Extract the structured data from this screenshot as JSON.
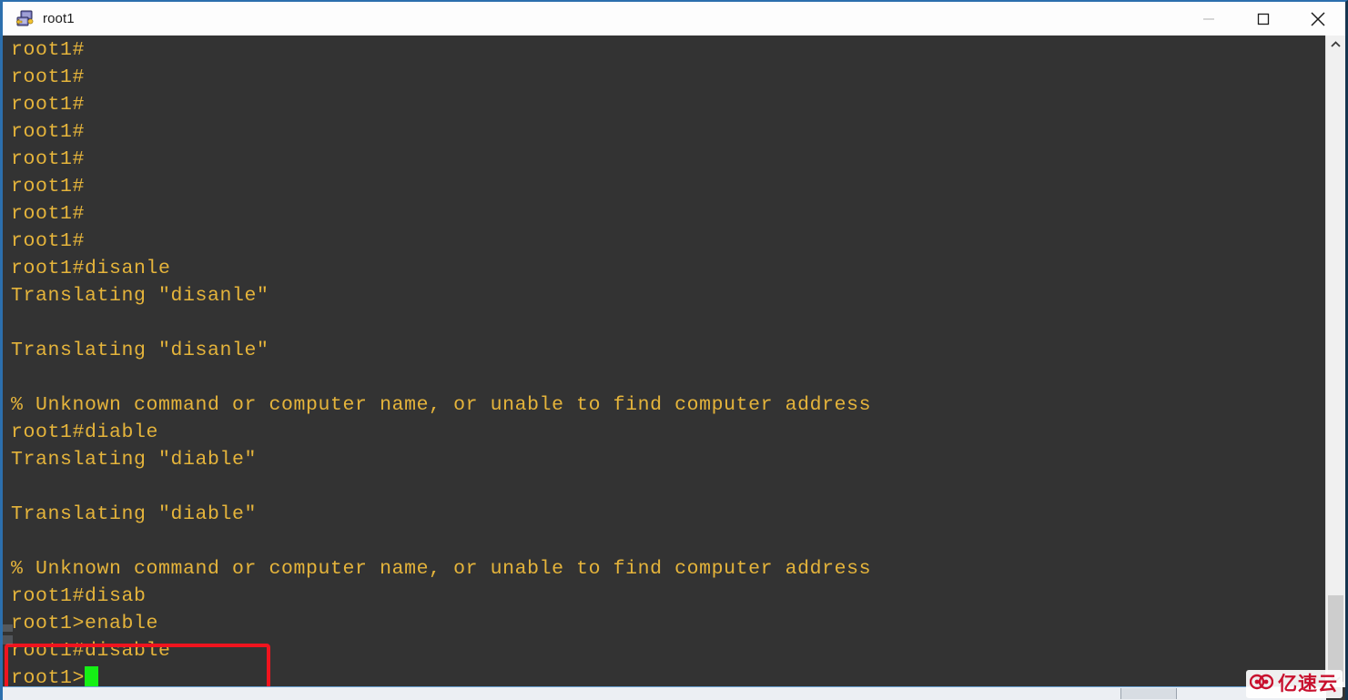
{
  "window": {
    "title": "root1",
    "icon": "remote-computer-icon",
    "controls": {
      "minimize": "minimize-icon",
      "maximize": "maximize-icon",
      "close": "close-icon"
    }
  },
  "terminal": {
    "foreground_color": "#e5b43b",
    "background_color": "#333333",
    "cursor_color": "#15f015",
    "lines": [
      "root1#",
      "root1#",
      "root1#",
      "root1#",
      "root1#",
      "root1#",
      "root1#",
      "root1#",
      "root1#disanle",
      "Translating \"disanle\"",
      "",
      "Translating \"disanle\"",
      "",
      "% Unknown command or computer name, or unable to find computer address",
      "root1#diable",
      "Translating \"diable\"",
      "",
      "Translating \"diable\"",
      "",
      "% Unknown command or computer name, or unable to find computer address",
      "root1#disab",
      "root1>enable",
      "root1#disable"
    ],
    "prompt_line": "root1>"
  },
  "annotation": {
    "color": "#f0141e",
    "highlighted_lines": [
      "root1>enable",
      "root1#disable"
    ]
  },
  "scrollbars": {
    "vertical": {
      "up_arrow": "chevron-up-icon",
      "down_arrow": "chevron-down-icon"
    },
    "horizontal": {}
  },
  "watermark": {
    "text": "亿速云",
    "logo": "cloud-logo-icon",
    "color": "#c8102e"
  }
}
